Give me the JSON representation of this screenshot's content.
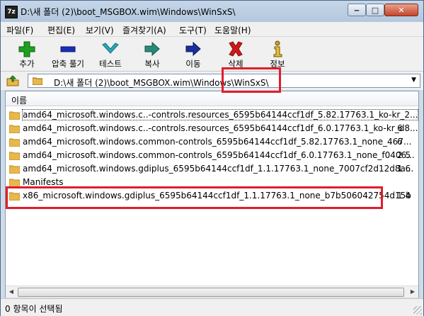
{
  "window": {
    "app_icon": "7z",
    "title": "D:\\새 폴더 (2)\\boot_MSGBOX.wim\\Windows\\WinSxS\\",
    "buttons": {
      "minimize": "‒",
      "maximize": "□",
      "close": "✕"
    }
  },
  "menu": [
    "파일(F)",
    "편집(E)",
    "보기(V)",
    "즐겨찾기(A)",
    "도구(T)",
    "도움말(H)"
  ],
  "toolbar": [
    {
      "label": "추가",
      "icon": "plus-icon",
      "color": "#1fa01f"
    },
    {
      "label": "압축 풀기",
      "icon": "minus-icon",
      "color": "#1a2fb0"
    },
    {
      "label": "테스트",
      "icon": "check-icon",
      "color": "#2aa7b8"
    },
    {
      "label": "복사",
      "icon": "copy-arrow-icon",
      "color": "#2a8a7a"
    },
    {
      "label": "이동",
      "icon": "move-arrow-icon",
      "color": "#1a2f9a"
    },
    {
      "label": "삭제",
      "icon": "delete-x-icon",
      "color": "#d01818"
    },
    {
      "label": "정보",
      "icon": "info-icon",
      "color": "#c8a018"
    }
  ],
  "address": {
    "path": "D:\\새 폴더 (2)\\boot_MSGBOX.wim\\Windows\\WinSxS\\"
  },
  "list": {
    "column_name": "이름",
    "rows": [
      {
        "name": "amd64_microsoft.windows.c..-controls.resources_6595b64144ccf1df_5.82.17763.1_ko-kr_2...",
        "size": ""
      },
      {
        "name": "amd64_microsoft.windows.c..-controls.resources_6595b64144ccf1df_6.0.17763.1_ko-kr_d8...",
        "size": "6"
      },
      {
        "name": "amd64_microsoft.windows.common-controls_6595b64144ccf1df_5.82.17763.1_none_467...",
        "size": "6"
      },
      {
        "name": "amd64_microsoft.windows.common-controls_6595b64144ccf1df_6.0.17763.1_none_f0406...",
        "size": "2 5"
      },
      {
        "name": "amd64_microsoft.windows.gdiplus_6595b64144ccf1df_1.1.17763.1_none_7007cf2d12d8a...",
        "size": "1 6"
      },
      {
        "name": "Manifests",
        "size": ""
      },
      {
        "name": "x86_microsoft.windows.gdiplus_6595b64144ccf1df_1.1.17763.1_none_b7b506042754d15b",
        "size": "1 4"
      }
    ]
  },
  "status": {
    "text": "0 항목이 선택됨"
  },
  "colors": {
    "highlight": "#e01d2c",
    "folder": "#e8b84a"
  }
}
